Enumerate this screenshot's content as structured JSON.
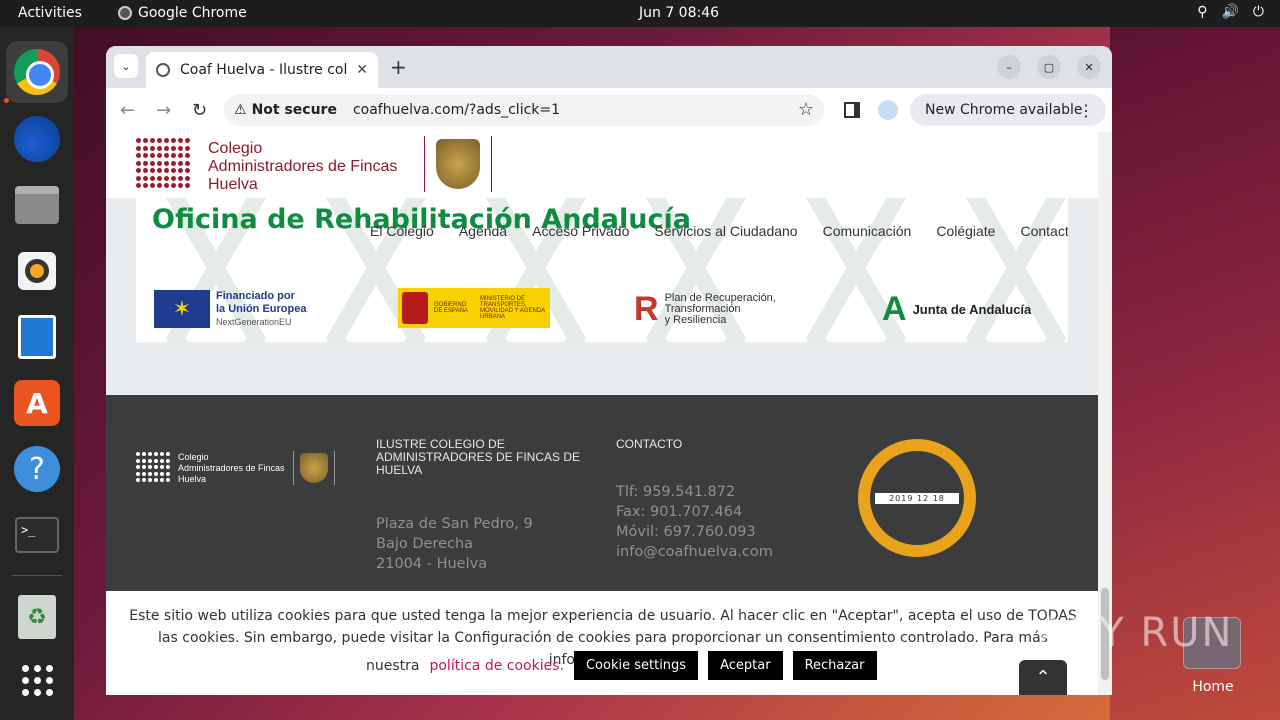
{
  "topbar": {
    "activities": "Activities",
    "app_name": "Google Chrome",
    "clock": "Jun 7  08:46"
  },
  "desktop": {
    "home_label": "Home"
  },
  "browser": {
    "tab_title": "Coaf Huelva - Ilustre cole",
    "not_secure": "Not secure",
    "url": "coafhuelva.com/?ads_click=1",
    "update_chip": "New Chrome available"
  },
  "site": {
    "logo_lines": [
      "Colegio",
      "Administradores de Fincas",
      "Huelva"
    ],
    "band_title": "Oficina de Rehabilitación Andalucía",
    "nav": [
      "El Colegio",
      "Agenda",
      "Acceso Privado",
      "Servicios al Ciudadano",
      "Comunicación",
      "Colégiate",
      "Contacto"
    ],
    "funding": {
      "eu_line1": "Financiado por",
      "eu_line2": "la Unión Europea",
      "eu_line3": "NextGenerationEU",
      "gob_line1": "GOBIERNO DE ESPAÑA",
      "gob_line2": "MINISTERIO DE TRANSPORTES, MOVILIDAD Y AGENDA URBANA",
      "plan_line1": "Plan de Recuperación,",
      "plan_line2": "Transformación",
      "plan_line3": "y Resiliencia",
      "junta": "Junta de Andalucía"
    },
    "footer": {
      "logo_lines": [
        "Colegio",
        "Administradores de Fincas",
        "Huelva"
      ],
      "col1_heading": "ILUSTRE COLEGIO DE ADMINISTRADORES DE FINCAS DE HUELVA",
      "address": [
        "Plaza de San Pedro, 9",
        "Bajo Derecha",
        "21004 - Huelva"
      ],
      "col2_heading": "CONTACTO",
      "contact": [
        "Tlf: 959.541.872",
        "Fax: 901.707.464",
        "Móvil: 697.760.093",
        "info@coafhuelva.com"
      ],
      "badge_date": "2019 12 18"
    },
    "cookie": {
      "text": "Este sitio web utiliza cookies para que usted tenga la mejor experiencia de usuario. Al hacer clic en \"Aceptar\", acepta el uso de TODAS las cookies. Sin embargo, puede visitar la Configuración de cookies para proporcionar un consentimiento controlado. Para más información lea",
      "prefix": "nuestra",
      "link": "política de cookies.",
      "settings": "Cookie settings",
      "accept": "Aceptar",
      "reject": "Rechazar"
    }
  },
  "watermark": "ANY RUN"
}
